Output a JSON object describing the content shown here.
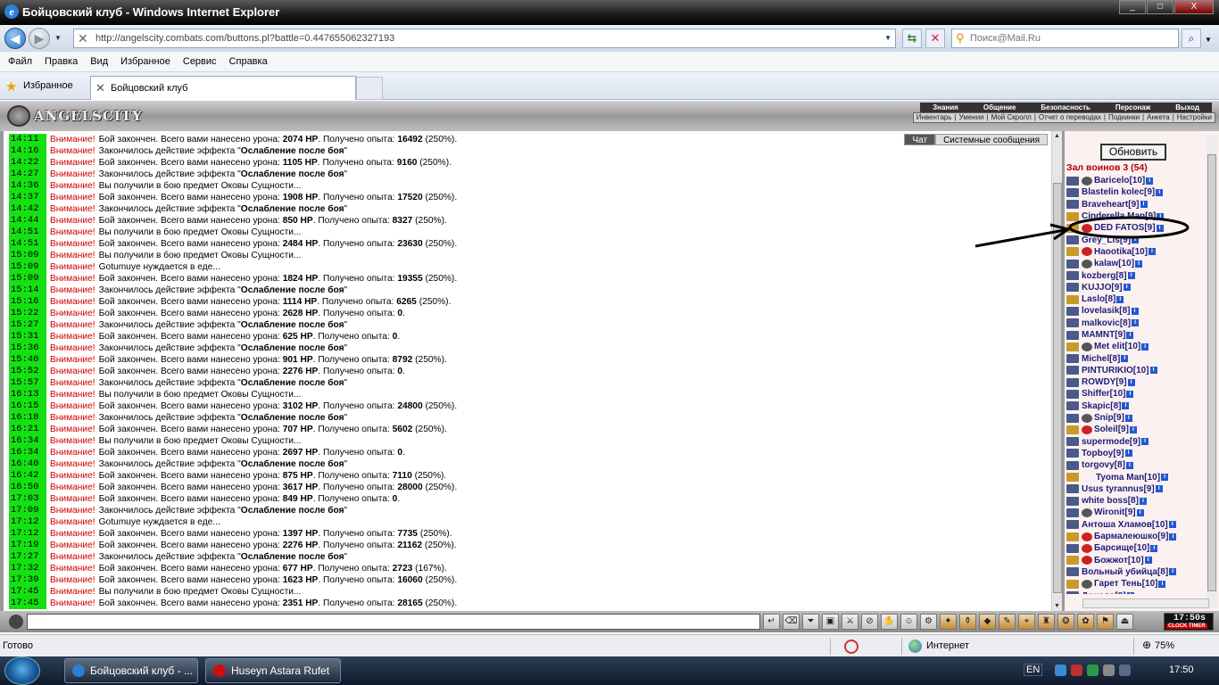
{
  "window": {
    "title": "Бойцовский клуб - Windows Internet Explorer",
    "buttons": [
      "_",
      "□",
      "X"
    ]
  },
  "address": {
    "url": "http://angelscity.combats.com/buttons.pl?battle=0.447655062327193",
    "search_placeholder": "Поиск@Mail.Ru"
  },
  "menu": [
    "Файл",
    "Правка",
    "Вид",
    "Избранное",
    "Сервис",
    "Справка"
  ],
  "favorites_label": "Избранное",
  "tab_title": "Бойцовский клуб",
  "game": {
    "logo": "ANGELSCITY",
    "nav_top": [
      "Знания",
      "Общение",
      "Безопасность",
      "Персонаж",
      "Выход"
    ],
    "nav_bottom": [
      "Инвентарь",
      "Умения",
      "Мой Скролл",
      "Отчет о переводах",
      "Подкинки",
      "Анкета",
      "Настройки"
    ]
  },
  "chat": {
    "tabs": [
      "Чат",
      "Системные сообщения"
    ],
    "warning": "Внимание!",
    "messages": [
      {
        "time": "14:11",
        "pre": "Бой закончен. Всего вами нанесено урона: ",
        "b1": "2074 HP",
        "mid": ". Получено опыта: ",
        "b2": "16492",
        "post": " (250%)."
      },
      {
        "time": "14:16",
        "pre": "Закончилось действие эффекта \"",
        "b1": "Ослабление после боя",
        "mid": "\"",
        "b2": "",
        "post": ""
      },
      {
        "time": "14:22",
        "pre": "Бой закончен. Всего вами нанесено урона: ",
        "b1": "1105 HP",
        "mid": ". Получено опыта: ",
        "b2": "9160",
        "post": " (250%)."
      },
      {
        "time": "14:27",
        "pre": "Закончилось действие эффекта \"",
        "b1": "Ослабление после боя",
        "mid": "\"",
        "b2": "",
        "post": ""
      },
      {
        "time": "14:36",
        "pre": "Вы получили в бою предмет Оковы Сущности...",
        "b1": "",
        "mid": "",
        "b2": "",
        "post": ""
      },
      {
        "time": "14:37",
        "pre": "Бой закончен. Всего вами нанесено урона: ",
        "b1": "1908 HP",
        "mid": ". Получено опыта: ",
        "b2": "17520",
        "post": " (250%)."
      },
      {
        "time": "14:42",
        "pre": "Закончилось действие эффекта \"",
        "b1": "Ослабление после боя",
        "mid": "\"",
        "b2": "",
        "post": ""
      },
      {
        "time": "14:44",
        "pre": "Бой закончен. Всего вами нанесено урона: ",
        "b1": "850 HP",
        "mid": ". Получено опыта: ",
        "b2": "8327",
        "post": " (250%)."
      },
      {
        "time": "14:51",
        "pre": "Вы получили в бою предмет Оковы Сущности...",
        "b1": "",
        "mid": "",
        "b2": "",
        "post": ""
      },
      {
        "time": "14:51",
        "pre": "Бой закончен. Всего вами нанесено урона: ",
        "b1": "2484 HP",
        "mid": ". Получено опыта: ",
        "b2": "23630",
        "post": " (250%)."
      },
      {
        "time": "15:09",
        "pre": "Вы получили в бою предмет Оковы Сущности...",
        "b1": "",
        "mid": "",
        "b2": "",
        "post": ""
      },
      {
        "time": "15:09",
        "pre": "Gotumuye нуждается в еде...",
        "b1": "",
        "mid": "",
        "b2": "",
        "post": ""
      },
      {
        "time": "15:09",
        "pre": "Бой закончен. Всего вами нанесено урона: ",
        "b1": "1824 HP",
        "mid": ". Получено опыта: ",
        "b2": "19355",
        "post": " (250%)."
      },
      {
        "time": "15:14",
        "pre": "Закончилось действие эффекта \"",
        "b1": "Ослабление после боя",
        "mid": "\"",
        "b2": "",
        "post": ""
      },
      {
        "time": "15:16",
        "pre": "Бой закончен. Всего вами нанесено урона: ",
        "b1": "1114 HP",
        "mid": ". Получено опыта: ",
        "b2": "6265",
        "post": " (250%)."
      },
      {
        "time": "15:22",
        "pre": "Бой закончен. Всего вами нанесено урона: ",
        "b1": "2628 HP",
        "mid": ". Получено опыта: ",
        "b2": "0",
        "post": "."
      },
      {
        "time": "15:27",
        "pre": "Закончилось действие эффекта \"",
        "b1": "Ослабление после боя",
        "mid": "\"",
        "b2": "",
        "post": ""
      },
      {
        "time": "15:31",
        "pre": "Бой закончен. Всего вами нанесено урона: ",
        "b1": "625 HP",
        "mid": ". Получено опыта: ",
        "b2": "0",
        "post": "."
      },
      {
        "time": "15:36",
        "pre": "Закончилось действие эффекта \"",
        "b1": "Ослабление после боя",
        "mid": "\"",
        "b2": "",
        "post": ""
      },
      {
        "time": "15:40",
        "pre": "Бой закончен. Всего вами нанесено урона: ",
        "b1": "901 HP",
        "mid": ". Получено опыта: ",
        "b2": "8792",
        "post": " (250%)."
      },
      {
        "time": "15:52",
        "pre": "Бой закончен. Всего вами нанесено урона: ",
        "b1": "2276 HP",
        "mid": ". Получено опыта: ",
        "b2": "0",
        "post": "."
      },
      {
        "time": "15:57",
        "pre": "Закончилось действие эффекта \"",
        "b1": "Ослабление после боя",
        "mid": "\"",
        "b2": "",
        "post": ""
      },
      {
        "time": "16:13",
        "pre": "Вы получили в бою предмет Оковы Сущности...",
        "b1": "",
        "mid": "",
        "b2": "",
        "post": ""
      },
      {
        "time": "16:15",
        "pre": "Бой закончен. Всего вами нанесено урона: ",
        "b1": "3102 HP",
        "mid": ". Получено опыта: ",
        "b2": "24800",
        "post": " (250%)."
      },
      {
        "time": "16:18",
        "pre": "Закончилось действие эффекта \"",
        "b1": "Ослабление после боя",
        "mid": "\"",
        "b2": "",
        "post": ""
      },
      {
        "time": "16:21",
        "pre": "Бой закончен. Всего вами нанесено урона: ",
        "b1": "707 HP",
        "mid": ". Получено опыта: ",
        "b2": "5602",
        "post": " (250%)."
      },
      {
        "time": "16:34",
        "pre": "Вы получили в бою предмет Оковы Сущности...",
        "b1": "",
        "mid": "",
        "b2": "",
        "post": ""
      },
      {
        "time": "16:34",
        "pre": "Бой закончен. Всего вами нанесено урона: ",
        "b1": "2697 HP",
        "mid": ". Получено опыта: ",
        "b2": "0",
        "post": "."
      },
      {
        "time": "16:40",
        "pre": "Закончилось действие эффекта \"",
        "b1": "Ослабление после боя",
        "mid": "\"",
        "b2": "",
        "post": ""
      },
      {
        "time": "16:42",
        "pre": "Бой закончен. Всего вами нанесено урона: ",
        "b1": "875 HP",
        "mid": ". Получено опыта: ",
        "b2": "7110",
        "post": " (250%)."
      },
      {
        "time": "16:50",
        "pre": "Бой закончен. Всего вами нанесено урона: ",
        "b1": "3617 HP",
        "mid": ". Получено опыта: ",
        "b2": "28000",
        "post": " (250%)."
      },
      {
        "time": "17:03",
        "pre": "Бой закончен. Всего вами нанесено урона: ",
        "b1": "849 HP",
        "mid": ". Получено опыта: ",
        "b2": "0",
        "post": "."
      },
      {
        "time": "17:09",
        "pre": "Закончилось действие эффекта \"",
        "b1": "Ослабление после боя",
        "mid": "\"",
        "b2": "",
        "post": ""
      },
      {
        "time": "17:12",
        "pre": "Gotumuye нуждается в еде...",
        "b1": "",
        "mid": "",
        "b2": "",
        "post": ""
      },
      {
        "time": "17:12",
        "pre": "Бой закончен. Всего вами нанесено урона: ",
        "b1": "1397 HP",
        "mid": ". Получено опыта: ",
        "b2": "7735",
        "post": " (250%)."
      },
      {
        "time": "17:19",
        "pre": "Бой закончен. Всего вами нанесено урона: ",
        "b1": "2276 HP",
        "mid": ". Получено опыта: ",
        "b2": "21162",
        "post": " (250%)."
      },
      {
        "time": "17:27",
        "pre": "Закончилось действие эффекта \"",
        "b1": "Ослабление после боя",
        "mid": "\"",
        "b2": "",
        "post": ""
      },
      {
        "time": "17:32",
        "pre": "Бой закончен. Всего вами нанесено урона: ",
        "b1": "677 HP",
        "mid": ". Получено опыта: ",
        "b2": "2723",
        "post": " (167%)."
      },
      {
        "time": "17:39",
        "pre": "Бой закончен. Всего вами нанесено урона: ",
        "b1": "1623 HP",
        "mid": ". Получено опыта: ",
        "b2": "16060",
        "post": " (250%)."
      },
      {
        "time": "17:45",
        "pre": "Вы получили в бою предмет Оковы Сущности...",
        "b1": "",
        "mid": "",
        "b2": "",
        "post": ""
      },
      {
        "time": "17:45",
        "pre": "Бой закончен. Всего вами нанесено урона: ",
        "b1": "2351 HP",
        "mid": ". Получено опыта: ",
        "b2": "28165",
        "post": " (250%)."
      }
    ]
  },
  "panel": {
    "refresh_label": "Обновить",
    "hall_title": "Зал воинов 3 (54)",
    "players": [
      {
        "name": "Baricelo",
        "level": "[10]",
        "crown": false,
        "ext": "dark"
      },
      {
        "name": "Blastelin kolec",
        "level": "[9]",
        "crown": false,
        "ext": "none"
      },
      {
        "name": "Braveheart",
        "level": "[9]",
        "crown": false,
        "ext": "none"
      },
      {
        "name": "Cinderella Man",
        "level": "[9]",
        "crown": true,
        "ext": "none"
      },
      {
        "name": "DED FATOS",
        "level": "[9]",
        "crown": true,
        "ext": "red"
      },
      {
        "name": "Grey_Lis",
        "level": "[9]",
        "crown": false,
        "ext": "none"
      },
      {
        "name": "Haootika",
        "level": "[10]",
        "crown": true,
        "ext": "red"
      },
      {
        "name": "kalaw",
        "level": "[10]",
        "crown": false,
        "ext": "dark"
      },
      {
        "name": "kozberg",
        "level": "[8]",
        "crown": false,
        "ext": "none"
      },
      {
        "name": "KUJJO",
        "level": "[9]",
        "crown": false,
        "ext": "none"
      },
      {
        "name": "Laslo",
        "level": "[8]",
        "crown": true,
        "ext": "none"
      },
      {
        "name": "lovelasik",
        "level": "[8]",
        "crown": false,
        "ext": "none"
      },
      {
        "name": "malkovic",
        "level": "[8]",
        "crown": false,
        "ext": "none"
      },
      {
        "name": "MAMNT",
        "level": "[9]",
        "crown": false,
        "ext": "none"
      },
      {
        "name": "Met elit",
        "level": "[10]",
        "crown": true,
        "ext": "dark"
      },
      {
        "name": "Michel",
        "level": "[8]",
        "crown": false,
        "ext": "none"
      },
      {
        "name": "PINTURIKIO",
        "level": "[10]",
        "crown": false,
        "ext": "none"
      },
      {
        "name": "ROWDY",
        "level": "[9]",
        "crown": false,
        "ext": "none"
      },
      {
        "name": "Shiffer",
        "level": "[10]",
        "crown": false,
        "ext": "none"
      },
      {
        "name": "Skapic",
        "level": "[8]",
        "crown": false,
        "ext": "none"
      },
      {
        "name": "Snip",
        "level": "[9]",
        "crown": false,
        "ext": "dark"
      },
      {
        "name": "Soleil",
        "level": "[9]",
        "crown": true,
        "ext": "red"
      },
      {
        "name": "supermode",
        "level": "[9]",
        "crown": false,
        "ext": "none"
      },
      {
        "name": "Topboy",
        "level": "[9]",
        "crown": false,
        "ext": "none"
      },
      {
        "name": "torgovy",
        "level": "[8]",
        "crown": false,
        "ext": "none"
      },
      {
        "name": "Tyoma Man",
        "level": "[10]",
        "crown": true,
        "ext": "blank"
      },
      {
        "name": "Usus tyrannus",
        "level": "[9]",
        "crown": false,
        "ext": "none"
      },
      {
        "name": "white boss",
        "level": "[8]",
        "crown": false,
        "ext": "none"
      },
      {
        "name": "Wironit",
        "level": "[9]",
        "crown": false,
        "ext": "dark"
      },
      {
        "name": "Антоша Хламов",
        "level": "[10]",
        "crown": false,
        "ext": "none"
      },
      {
        "name": "Бармалеюшко",
        "level": "[9]",
        "crown": true,
        "ext": "red"
      },
      {
        "name": "Барсище",
        "level": "[10]",
        "crown": false,
        "ext": "red"
      },
      {
        "name": "Божжот",
        "level": "[10]",
        "crown": true,
        "ext": "red"
      },
      {
        "name": "Вольный убийца",
        "level": "[8]",
        "crown": false,
        "ext": "none"
      },
      {
        "name": "Гарет Тень",
        "level": "[10]",
        "crown": true,
        "ext": "dark"
      },
      {
        "name": "Донадо",
        "level": "[9]",
        "crown": false,
        "ext": "none"
      }
    ]
  },
  "bottom": {
    "clock_time": "17:50s",
    "clock_label": "CLOCK TIMER"
  },
  "status": {
    "ready": "Готово",
    "zone": "Интернет",
    "zoom": "75%"
  },
  "taskbar": {
    "tasks": [
      "Бойцовский клуб - ...",
      "Huseyn Astara Rufet ..."
    ],
    "lang": "EN",
    "clock": "17:50"
  },
  "colors": {
    "time_bg": "#14e014",
    "warning": "#d10000",
    "player_name": "#1d1d7a",
    "hall_title": "#b00000"
  }
}
